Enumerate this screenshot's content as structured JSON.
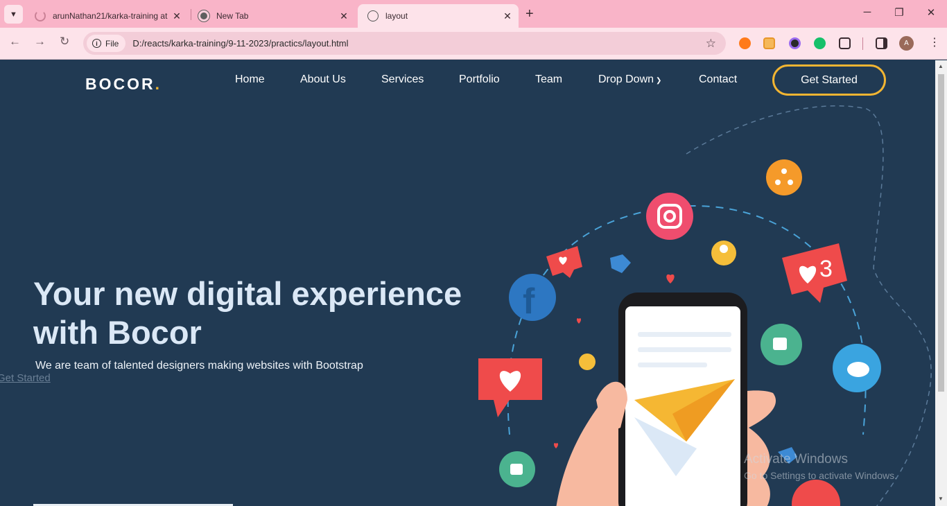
{
  "browser": {
    "tabs": [
      {
        "title": "arunNathan21/karka-training at"
      },
      {
        "title": "New Tab"
      },
      {
        "title": "layout"
      }
    ],
    "chip_label": "File",
    "url": "D:/reacts/karka-training/9-11-2023/practics/layout.html",
    "profile_initial": "A",
    "colors": {
      "tabstrip": "#f9b4c8",
      "toolbar": "#fde3ea"
    }
  },
  "nav": {
    "logo": "BOCOR",
    "logo_dot": ".",
    "links": [
      "Home",
      "About Us",
      "Services",
      "Portfolio",
      "Team",
      "Drop Down",
      "Contact"
    ],
    "cta": "Get Started"
  },
  "hero": {
    "title": "Your new digital experience with Bocor",
    "subtitle": "We are team of talented designers making websites with Bootstrap",
    "link": "Get Started"
  },
  "illustration": {
    "badge_count": "3"
  },
  "watermark": {
    "line1": "Activate Windows",
    "line2": "Go to Settings to activate Windows."
  },
  "colors": {
    "page_bg": "#213a53",
    "accent": "#f2b532",
    "hero_text": "#dbe8f6"
  }
}
